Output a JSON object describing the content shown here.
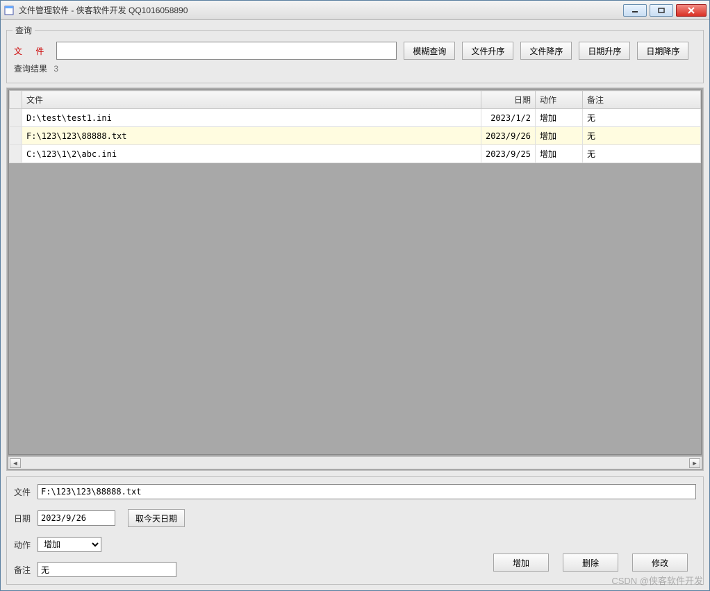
{
  "window": {
    "title": "文件管理软件  - 侠客软件开发  QQ1016058890"
  },
  "query": {
    "legend": "查询",
    "file_label": "文 件",
    "search_value": "",
    "buttons": {
      "fuzzy": "模糊查询",
      "file_asc": "文件升序",
      "file_desc": "文件降序",
      "date_asc": "日期升序",
      "date_desc": "日期降序"
    },
    "results_label": "查询结果",
    "results_count": "3"
  },
  "grid": {
    "headers": {
      "file": "文件",
      "date": "日期",
      "action": "动作",
      "note": "备注"
    },
    "rows": [
      {
        "file": "D:\\test\\test1.ini",
        "date": "2023/1/2",
        "action": "增加",
        "note": "无",
        "selected": false
      },
      {
        "file": "F:\\123\\123\\88888.txt",
        "date": "2023/9/26",
        "action": "增加",
        "note": "无",
        "selected": true
      },
      {
        "file": "C:\\123\\1\\2\\abc.ini",
        "date": "2023/9/25",
        "action": "增加",
        "note": "无",
        "selected": false
      }
    ]
  },
  "form": {
    "labels": {
      "file": "文件",
      "date": "日期",
      "action": "动作",
      "note": "备注"
    },
    "file_value": "F:\\123\\123\\88888.txt",
    "date_value": "2023/9/26",
    "today_button": "取今天日期",
    "action_value": "增加",
    "note_value": "无",
    "buttons": {
      "add": "增加",
      "delete": "删除",
      "modify": "修改"
    }
  },
  "watermark": "CSDN @侠客软件开发"
}
